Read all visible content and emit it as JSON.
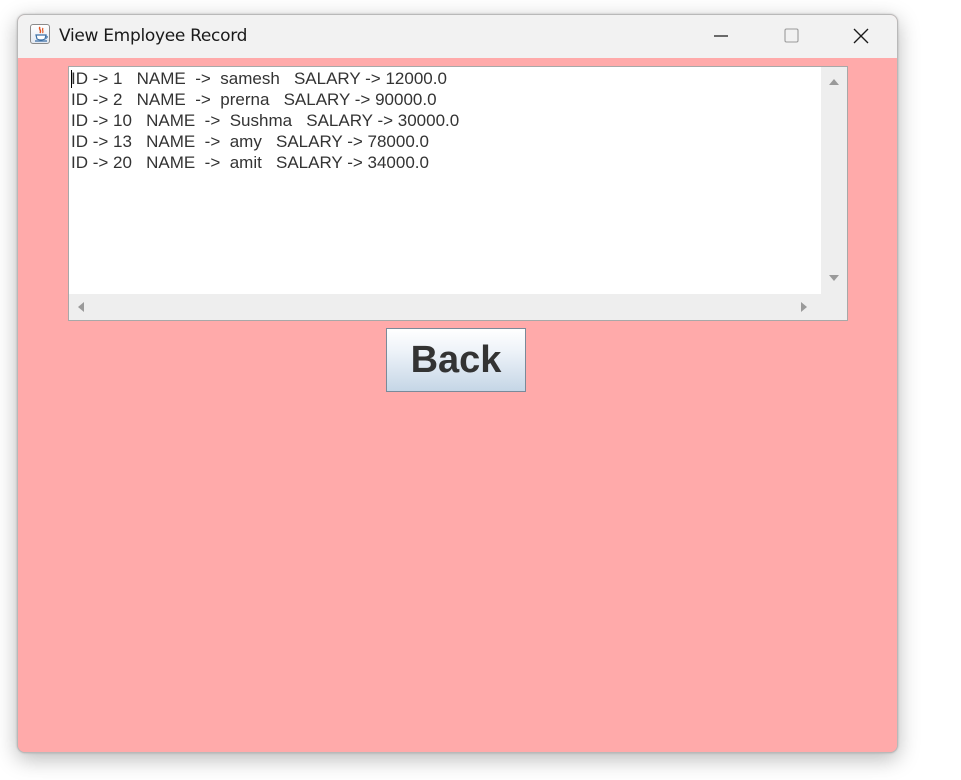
{
  "window": {
    "title": "View Employee Record",
    "icon": "java-cup-icon",
    "background_color": "#ffaaaa"
  },
  "titlebar_controls": [
    "minimize-icon",
    "maximize-icon",
    "close-icon"
  ],
  "records": [
    "ID -> 1   NAME  ->  samesh   SALARY -> 12000.0",
    "ID -> 2   NAME  ->  prerna   SALARY -> 90000.0",
    "ID -> 10   NAME  ->  Sushma   SALARY -> 30000.0",
    "ID -> 13   NAME  ->  amy   SALARY -> 78000.0",
    "ID -> 20   NAME  ->  amit   SALARY -> 34000.0"
  ],
  "back_button": {
    "label": "Back"
  }
}
